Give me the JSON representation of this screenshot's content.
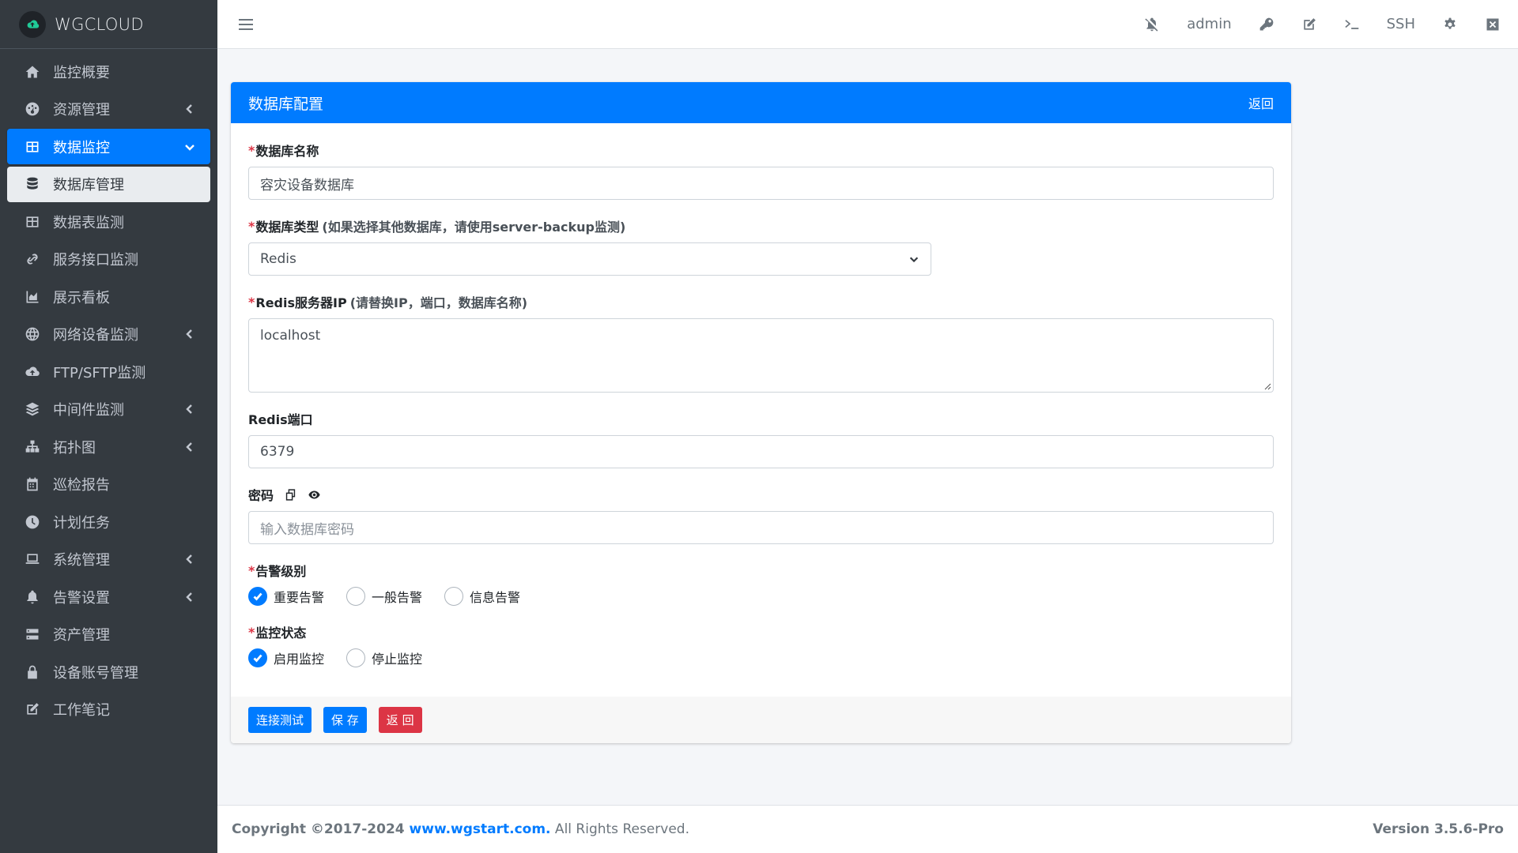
{
  "brand": {
    "name": "WGCLOUD"
  },
  "sidebar": {
    "items": [
      {
        "label": "监控概要",
        "icon": "home-icon"
      },
      {
        "label": "资源管理",
        "icon": "dashboard-icon"
      },
      {
        "label": "数据监控",
        "icon": "table-icon"
      },
      {
        "label": "数据库管理",
        "icon": "database-icon"
      },
      {
        "label": "数据表监测",
        "icon": "table-icon"
      },
      {
        "label": "服务接口监测",
        "icon": "link-icon"
      },
      {
        "label": "展示看板",
        "icon": "chart-area-icon"
      },
      {
        "label": "网络设备监测",
        "icon": "globe-icon"
      },
      {
        "label": "FTP/SFTP监测",
        "icon": "cloud-upload-icon"
      },
      {
        "label": "中间件监测",
        "icon": "layers-icon"
      },
      {
        "label": "拓扑图",
        "icon": "sitemap-icon"
      },
      {
        "label": "巡检报告",
        "icon": "calendar-icon"
      },
      {
        "label": "计划任务",
        "icon": "clock-icon"
      },
      {
        "label": "系统管理",
        "icon": "laptop-icon"
      },
      {
        "label": "告警设置",
        "icon": "bell-icon"
      },
      {
        "label": "资产管理",
        "icon": "server-icon"
      },
      {
        "label": "设备账号管理",
        "icon": "lock-icon"
      },
      {
        "label": "工作笔记",
        "icon": "edit-icon"
      }
    ]
  },
  "topbar": {
    "user": "admin",
    "ssh": "SSH"
  },
  "card": {
    "title": "数据库配置",
    "back": "返回",
    "fields": {
      "name": {
        "label": "数据库名称",
        "value": "容灾设备数据库"
      },
      "type": {
        "label": "数据库类型",
        "hint": "(如果选择其他数据库，请使用server-backup监测)",
        "value": "Redis"
      },
      "ip": {
        "label": "Redis服务器IP",
        "hint": "(请替换IP，端口，数据库名称)",
        "value": "localhost"
      },
      "port": {
        "label": "Redis端口",
        "value": "6379"
      },
      "password": {
        "label": "密码",
        "placeholder": "输入数据库密码"
      },
      "alarm_level": {
        "label": "告警级别",
        "options": [
          "重要告警",
          "一般告警",
          "信息告警"
        ],
        "selected": "重要告警"
      },
      "monitor_state": {
        "label": "监控状态",
        "options": [
          "启用监控",
          "停止监控"
        ],
        "selected": "启用监控"
      }
    },
    "buttons": {
      "test": "连接测试",
      "save": "保 存",
      "back": "返 回"
    }
  },
  "footer": {
    "copyright": "Copyright ©2017-2024 ",
    "link": "www.wgstart.com.",
    "rights": " All Rights Reserved.",
    "version": "Version 3.5.6-Pro"
  },
  "colors": {
    "primary": "#007bff",
    "danger": "#dc3545",
    "sidebar_bg": "#343a40"
  }
}
